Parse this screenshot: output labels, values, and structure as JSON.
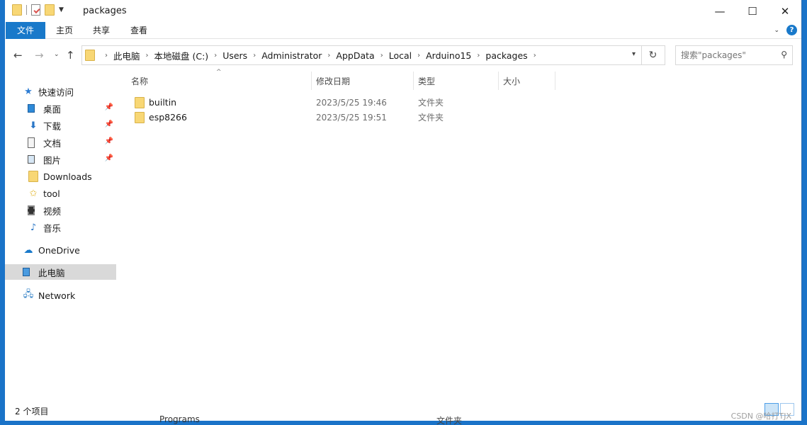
{
  "window": {
    "title": "packages"
  },
  "ribbon": {
    "tabs": [
      "文件",
      "主页",
      "共享",
      "查看"
    ],
    "help": "?"
  },
  "address": {
    "crumbs": [
      "此电脑",
      "本地磁盘 (C:)",
      "Users",
      "Administrator",
      "AppData",
      "Local",
      "Arduino15",
      "packages"
    ]
  },
  "search": {
    "placeholder": "搜索\"packages\""
  },
  "sidebar": {
    "quick_access": "快速访问",
    "items": [
      "桌面",
      "下载",
      "文档",
      "图片",
      "Downloads",
      "tool",
      "视频",
      "音乐"
    ],
    "onedrive": "OneDrive",
    "this_pc": "此电脑",
    "network": "Network"
  },
  "columns": {
    "name": "名称",
    "date": "修改日期",
    "type": "类型",
    "size": "大小"
  },
  "files": [
    {
      "name": "builtin",
      "date": "2023/5/25 19:46",
      "type": "文件夹"
    },
    {
      "name": "esp8266",
      "date": "2023/5/25 19:51",
      "type": "文件夹"
    }
  ],
  "status": {
    "count": "2 个项目"
  },
  "watermark": "CSDN @哈打TJX",
  "bleed": {
    "name": "Programs",
    "type": "文件夹"
  },
  "colors": {
    "accent": "#1979ca",
    "selected": "#d9d9d9",
    "desktop_bg": "#1a73c8"
  },
  "icons": {
    "folder": "folder-icon",
    "back": "back-arrow-icon",
    "forward": "forward-arrow-icon",
    "up": "up-arrow-icon",
    "refresh": "refresh-icon",
    "search": "search-icon",
    "pin": "pin-icon"
  }
}
